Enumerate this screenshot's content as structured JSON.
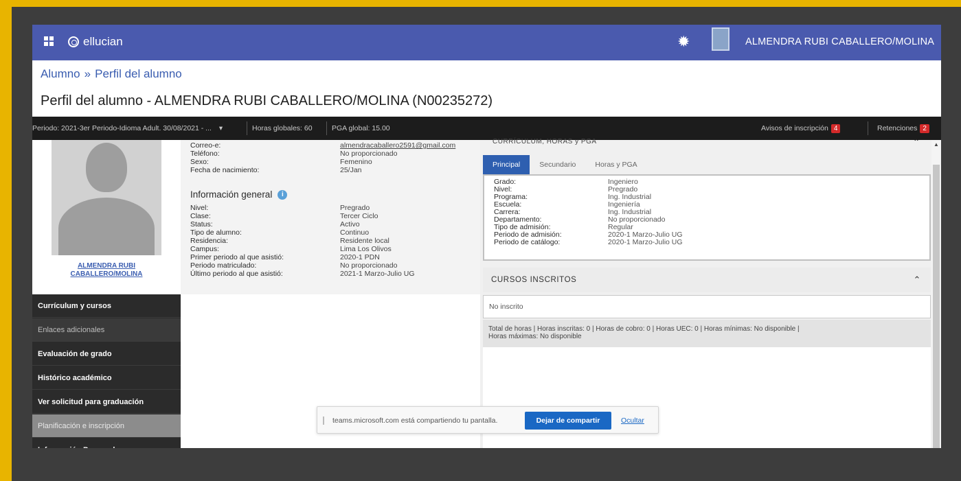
{
  "topbar": {
    "brand": "ellucian",
    "user_name": "ALMENDRA RUBI CABALLERO/MOLINA",
    "icons": [
      "apps-grid-icon",
      "ellucian-logo-icon",
      "settings-gear-icon",
      "user-avatar-icon"
    ],
    "color": "#4a5aae"
  },
  "breadcrumb": {
    "root": "Alumno",
    "separator": "»",
    "current": "Perfil del alumno"
  },
  "page_title": "Perfil del alumno - ALMENDRA RUBI CABALLERO/MOLINA (N00235272)",
  "infobar": {
    "periodo": "Periodo: 2021-3er Periodo-Idioma Adult. 30/08/2021 - ...",
    "horas_globales": "Horas globales: 60",
    "pga_global": "PGA global: 15.00",
    "avisos_label": "Avisos de inscripción",
    "avisos_count": "4",
    "retenciones_label": "Retenciones",
    "retenciones_count": "2",
    "badge_color": "#d42a2a"
  },
  "sidebar": {
    "student_name_line1": "ALMENDRA RUBI",
    "student_name_line2": "CABALLERO/MOLINA",
    "items": [
      {
        "label": "Currículum y cursos"
      },
      {
        "label": "Enlaces adicionales"
      },
      {
        "label": "Evaluación de grado"
      },
      {
        "label": "Histórico académico"
      },
      {
        "label": "Ver solicitud para graduación"
      },
      {
        "label": "Planificación e inscripción"
      },
      {
        "label": "Información Personal"
      }
    ]
  },
  "contact": [
    {
      "label": "Correo-e:",
      "value": "almendracaballero2591@gmail.com"
    },
    {
      "label": "Teléfono:",
      "value": "No proporcionado"
    },
    {
      "label": "Sexo:",
      "value": "Femenino"
    },
    {
      "label": "Fecha de nacimiento:",
      "value": "25/Jan"
    }
  ],
  "general_info": {
    "title": "Información general",
    "rows": [
      {
        "label": "Nivel:",
        "value": "Pregrado"
      },
      {
        "label": "Clase:",
        "value": "Tercer Ciclo"
      },
      {
        "label": "Status:",
        "value": "Activo"
      },
      {
        "label": "Tipo de alumno:",
        "value": "Continuo"
      },
      {
        "label": "Residencia:",
        "value": "Residente local"
      },
      {
        "label": "Campus:",
        "value": "Lima Los Olivos"
      },
      {
        "label": "Primer periodo al que asistió:",
        "value": "2020-1 PDN"
      },
      {
        "label": "Periodo matriculado:",
        "value": "No proporcionado"
      },
      {
        "label": "Último periodo al que asistió:",
        "value": "2021-1 Marzo-Julio UG"
      }
    ]
  },
  "curriculum": {
    "header": "CURRÍCULUM, HORAS y PGA",
    "tabs": [
      "Principal",
      "Secundario",
      "Horas y PGA"
    ],
    "rows": [
      {
        "label": "Grado:",
        "value": "Ingeniero"
      },
      {
        "label": "Nivel:",
        "value": "Pregrado"
      },
      {
        "label": "Programa:",
        "value": "Ing. Industrial"
      },
      {
        "label": "Escuela:",
        "value": "Ingeniería"
      },
      {
        "label": "Carrera:",
        "value": "Ing. Industrial"
      },
      {
        "label": "Departamento:",
        "value": "No proporcionado"
      },
      {
        "label": "Tipo de admisión:",
        "value": "Regular"
      },
      {
        "label": "Periodo de admisión:",
        "value": "2020-1 Marzo-Julio UG"
      },
      {
        "label": "Periodo de catálogo:",
        "value": "2020-1 Marzo-Julio UG"
      }
    ]
  },
  "courses": {
    "header": "CURSOS INSCRITOS",
    "empty_text": "No inscrito",
    "totals_line1": "Total de horas |  Horas inscritas:  0  |  Horas de cobro:  0  |  Horas UEC:  0  |  Horas mínimas:  No disponible  |",
    "totals_line2": "Horas máximas:  No disponible"
  },
  "sharebar": {
    "message": "teams.microsoft.com está compartiendo tu pantalla.",
    "stop_label": "Dejar de compartir",
    "hide_label": "Ocultar"
  }
}
